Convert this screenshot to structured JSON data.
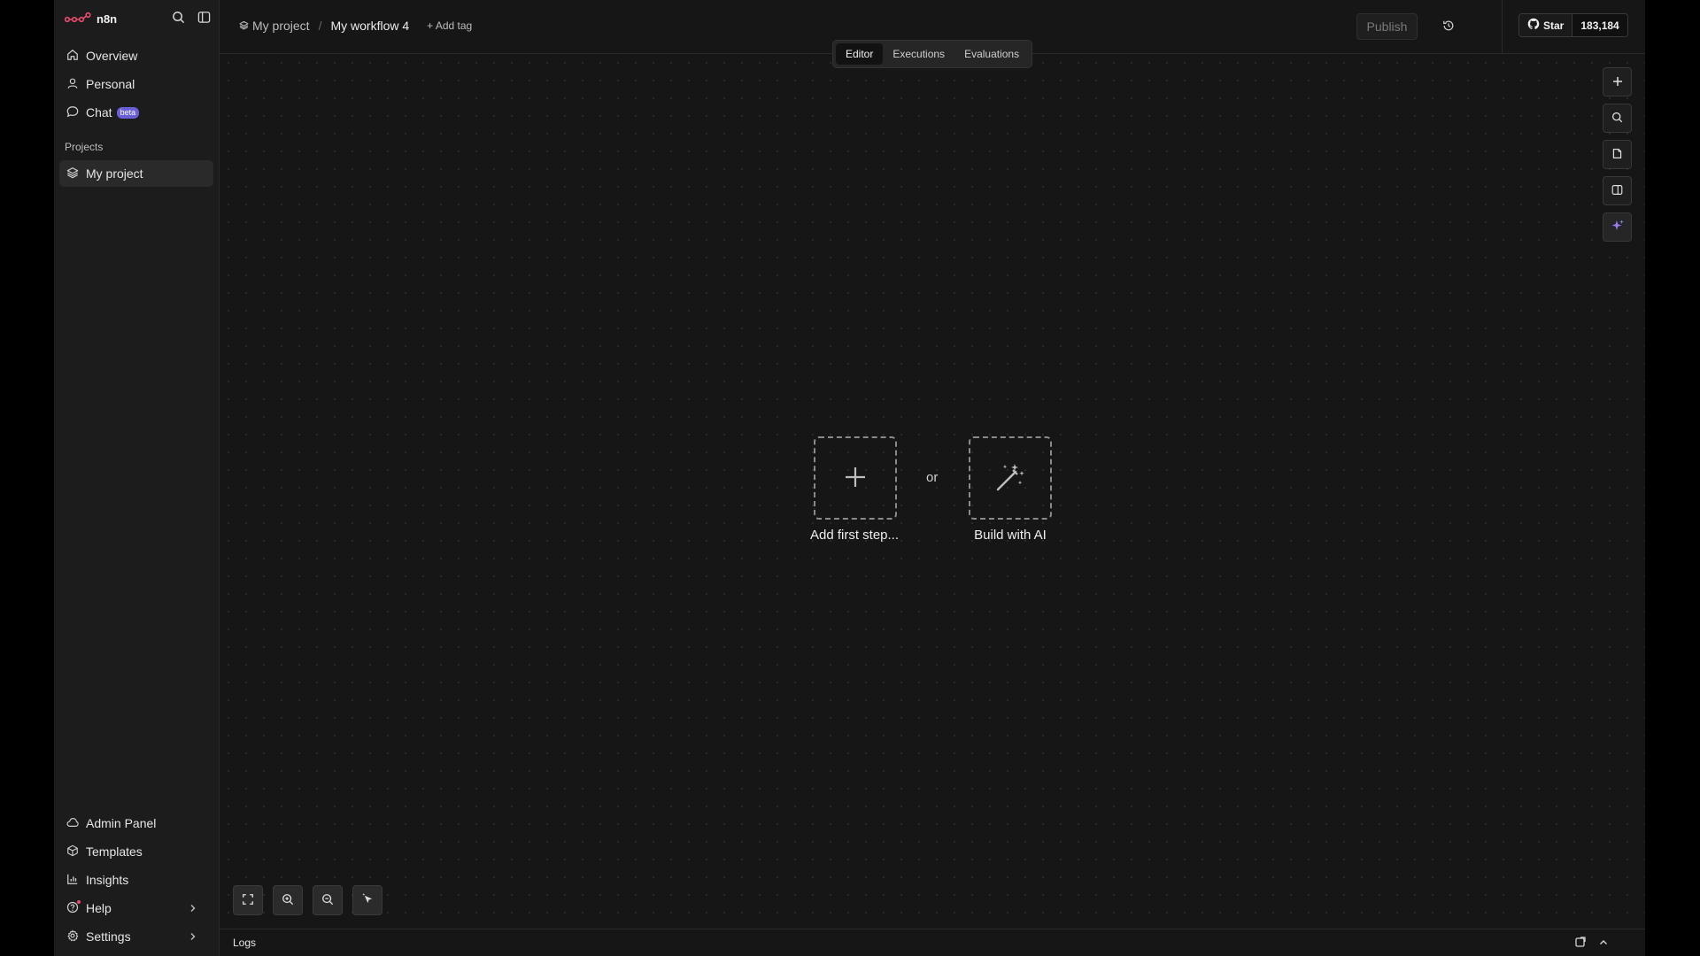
{
  "brand": {
    "name": "n8n",
    "accent": "#ea4b71",
    "icon": "n8n-logo-icon"
  },
  "sidebar": {
    "top_items": [
      {
        "label": "Overview",
        "icon": "home-icon"
      },
      {
        "label": "Personal",
        "icon": "user-icon"
      },
      {
        "label": "Chat",
        "icon": "chat-icon",
        "badge": "beta"
      }
    ],
    "projects_label": "Projects",
    "projects": [
      {
        "label": "My project",
        "icon": "layers-icon",
        "active": true
      }
    ],
    "bottom_items": [
      {
        "label": "Admin Panel",
        "icon": "cloud-icon"
      },
      {
        "label": "Templates",
        "icon": "templates-icon"
      },
      {
        "label": "Insights",
        "icon": "bar-chart-icon"
      },
      {
        "label": "Help",
        "icon": "help-icon"
      },
      {
        "label": "Settings",
        "icon": "gear-icon"
      }
    ]
  },
  "header": {
    "project": "My project",
    "separator": "/",
    "workflow": "My workflow 4",
    "add_tag": "+ Add tag",
    "publish": "Publish",
    "github_star": "Star",
    "github_count": "183,184"
  },
  "tabs": [
    {
      "label": "Editor",
      "active": true
    },
    {
      "label": "Executions",
      "active": false
    },
    {
      "label": "Evaluations",
      "active": false
    }
  ],
  "canvas": {
    "add_first_step": "Add first step...",
    "or": "or",
    "build_with_ai": "Build with AI"
  },
  "logs": {
    "label": "Logs"
  }
}
